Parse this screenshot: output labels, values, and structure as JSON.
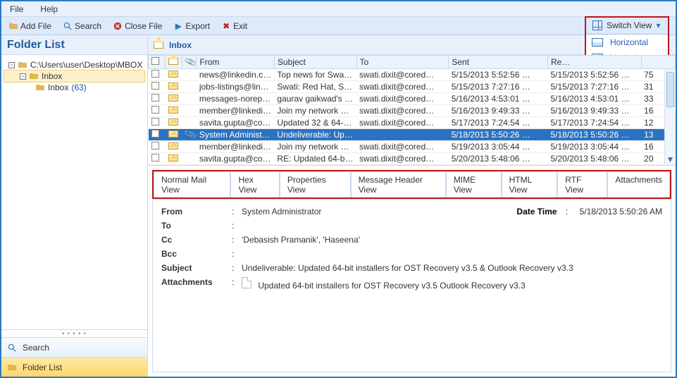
{
  "menu": {
    "file": "File",
    "help": "Help"
  },
  "toolbar": {
    "add_file": "Add File",
    "search": "Search",
    "close_file": "Close File",
    "export": "Export",
    "exit": "Exit",
    "switch_view": "Switch View",
    "horizontal": "Horizontal",
    "vertical": "Vertical"
  },
  "left": {
    "title": "Folder List",
    "root": "C:\\Users\\user\\Desktop\\MBOX",
    "inbox": "Inbox",
    "inbox_sub": "Inbox",
    "inbox_count": "(63)",
    "search": "Search",
    "folder_list": "Folder List"
  },
  "inbox_title": "Inbox",
  "columns": {
    "from": "From",
    "subject": "Subject",
    "to": "To",
    "sent": "Sent",
    "received": "Re…",
    "size": ""
  },
  "rows": [
    {
      "from": "news@linkedin.c…",
      "subj": "Top news for Swa…",
      "to": "swati.dixit@cored…",
      "sent": "5/15/2013 5:52:56 …",
      "recv": "5/15/2013 5:52:56 …",
      "size": "75",
      "att": false,
      "sel": false
    },
    {
      "from": "jobs-listings@lin…",
      "subj": "Swati: Red Hat, Sli…",
      "to": "swati.dixit@cored…",
      "sent": "5/15/2013 7:27:16 …",
      "recv": "5/15/2013 7:27:16 …",
      "size": "31",
      "att": false,
      "sel": false
    },
    {
      "from": "messages-noreply…",
      "subj": "gaurav gaikwad's …",
      "to": "swati.dixit@cored…",
      "sent": "5/16/2013 4:53:01 …",
      "recv": "5/16/2013 4:53:01 …",
      "size": "33",
      "att": false,
      "sel": false
    },
    {
      "from": "member@linkedi…",
      "subj": "Join my network …",
      "to": "swati.dixit@cored…",
      "sent": "5/16/2013 9:49:33 …",
      "recv": "5/16/2013 9:49:33 …",
      "size": "16",
      "att": false,
      "sel": false
    },
    {
      "from": "savita.gupta@cor…",
      "subj": "Updated 32 & 64-…",
      "to": "swati.dixit@cored…",
      "sent": "5/17/2013 7:24:54 …",
      "recv": "5/17/2013 7:24:54 …",
      "size": "12",
      "att": false,
      "sel": false
    },
    {
      "from": "System Administr…",
      "subj": "Undeliverable: Up…",
      "to": "",
      "sent": "5/18/2013 5:50:26 …",
      "recv": "5/18/2013 5:50:26 …",
      "size": "13",
      "att": true,
      "sel": true
    },
    {
      "from": "member@linkedi…",
      "subj": "Join my network …",
      "to": "swati.dixit@cored…",
      "sent": "5/19/2013 3:05:44 …",
      "recv": "5/19/2013 3:05:44 …",
      "size": "16",
      "att": false,
      "sel": false
    },
    {
      "from": "savita.gupta@cor…",
      "subj": "RE: Updated 64-bi…",
      "to": "swati.dixit@cored…",
      "sent": "5/20/2013 5:48:06 …",
      "recv": "5/20/2013 5:48:06 …",
      "size": "20",
      "att": false,
      "sel": false
    }
  ],
  "tabs": [
    "Normal Mail View",
    "Hex View",
    "Properties View",
    "Message Header View",
    "MIME View",
    "HTML View",
    "RTF View",
    "Attachments"
  ],
  "detail": {
    "from_label": "From",
    "from": "System Administrator",
    "datetime_label": "Date Time",
    "datetime": "5/18/2013 5:50:26 AM",
    "to_label": "To",
    "to": "",
    "cc_label": "Cc",
    "cc": "'Debasish Pramanik',  'Haseena'",
    "bcc_label": "Bcc",
    "bcc": "",
    "subject_label": "Subject",
    "subject": "Undeliverable: Updated 64-bit installers for OST Recovery v3.5 & Outlook Recovery v3.3",
    "attach_label": "Attachments",
    "attach": "Updated 64-bit installers for OST Recovery v3.5  Outlook Recovery v3.3"
  }
}
